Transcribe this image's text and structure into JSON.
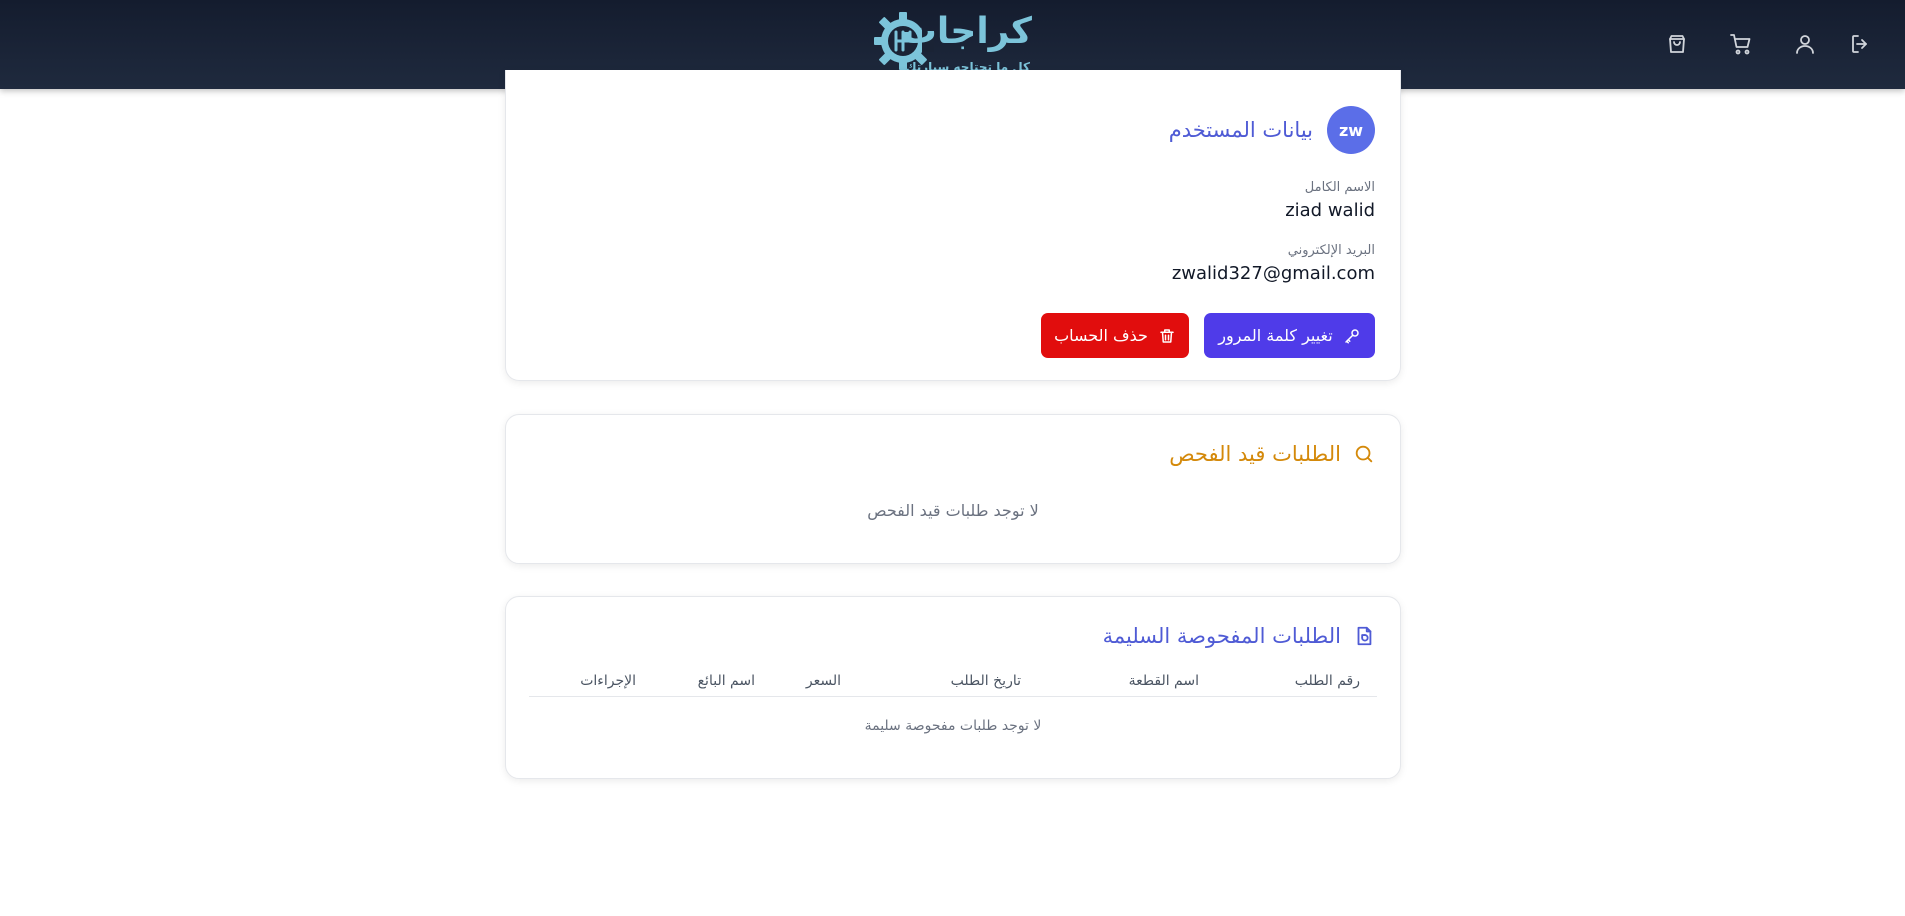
{
  "header": {
    "logo_title": "كراجات",
    "logo_tagline": "كل ما تحتاجه سيارتك",
    "icons": [
      "logout-icon",
      "user-icon",
      "cart-icon",
      "shopping-bag-icon"
    ]
  },
  "user_card": {
    "avatar_initials": "zw",
    "title": "بيانات المستخدم",
    "full_name_label": "الاسم الكامل",
    "full_name_value": "ziad walid",
    "email_label": "البريد الإلكتروني",
    "email_value": "zwalid327@gmail.com",
    "change_password_label": "تغيير كلمة المرور",
    "delete_account_label": "حذف الحساب"
  },
  "pending_card": {
    "title": "الطلبات قيد الفحص",
    "empty_text": "لا توجد طلبات قيد الفحص"
  },
  "approved_card": {
    "title": "الطلبات المفحوصة السليمة",
    "columns": [
      "رقم الطلب",
      "اسم القطعة",
      "تاريخ الطلب",
      "السعر",
      "اسم البائع",
      "الإجراءات"
    ],
    "empty_text": "لا توجد طلبات مفحوصة سليمة"
  },
  "colors": {
    "header_bg": "#1a2335",
    "logo": "#7cc4da",
    "primary": "#4f3be9",
    "danger": "#e10d0d",
    "title_blue": "#4f5bd5",
    "title_amber": "#d4890a",
    "avatar": "#5b6ee8"
  }
}
